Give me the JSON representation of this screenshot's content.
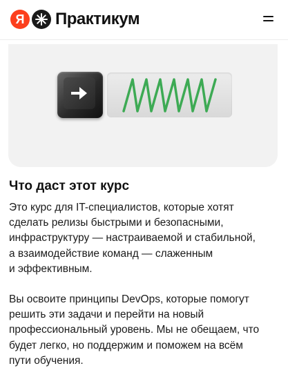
{
  "header": {
    "logo_ya": "Я",
    "logo_text": "Практикум",
    "icons": {
      "star": "snowflake-star-icon",
      "menu": "hamburger-menu-icon"
    }
  },
  "illustration": {
    "key_icon": "play-arrow-icon",
    "wave_icon": "zigzag-wave-icon",
    "wave_color": "#3daa54"
  },
  "section": {
    "title": "Что даст этот курс",
    "paragraph1_lines": [
      "Это курс для IT-специалистов, которые хотят",
      "сделать релизы быстрыми и безопасными,",
      "инфраструктуру — настраиваемой и стабильной,",
      "а взаимодействие команд — слаженным",
      "и эффективным."
    ],
    "paragraph2_lines": [
      "Вы освоите принципы DevOps, которые помогут",
      "решить эти задачи и перейти на новый",
      "профессиональный уровень. Мы не обещаем, что",
      "будет легко, но поддержим и поможем на всём",
      "пути обучения."
    ]
  },
  "colors": {
    "brand_red": "#fc3f1d",
    "card_bg": "#f2f2f2",
    "text": "#1a1a1a"
  }
}
